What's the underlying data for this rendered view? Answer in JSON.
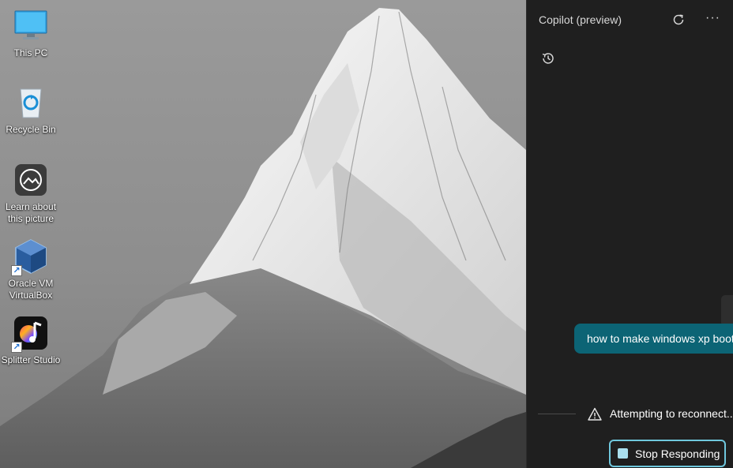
{
  "desktop": {
    "icons": [
      {
        "label": "This PC",
        "icon": "monitor-icon"
      },
      {
        "label": "Recycle Bin",
        "icon": "recycle-bin-icon"
      },
      {
        "label": "Learn about this picture",
        "icon": "camera-icon"
      },
      {
        "label": "Oracle VM VirtualBox",
        "icon": "virtualbox-icon",
        "shortcut": true
      },
      {
        "label": "Splitter Studio",
        "icon": "splitter-studio-icon",
        "shortcut": true
      }
    ]
  },
  "copilot": {
    "title": "Copilot (preview)",
    "refresh_icon": "refresh-icon",
    "more_icon": "more-icon",
    "more_glyph": "···",
    "history_icon": "history-icon",
    "user_message": "how to make windows xp boot",
    "status_text": "Attempting to reconnect...",
    "stop_button_label": "Stop Responding",
    "colors": {
      "panel_bg": "#1f1f1f",
      "bubble_bg": "#0c6475",
      "stop_border": "#6fc7dd"
    }
  }
}
